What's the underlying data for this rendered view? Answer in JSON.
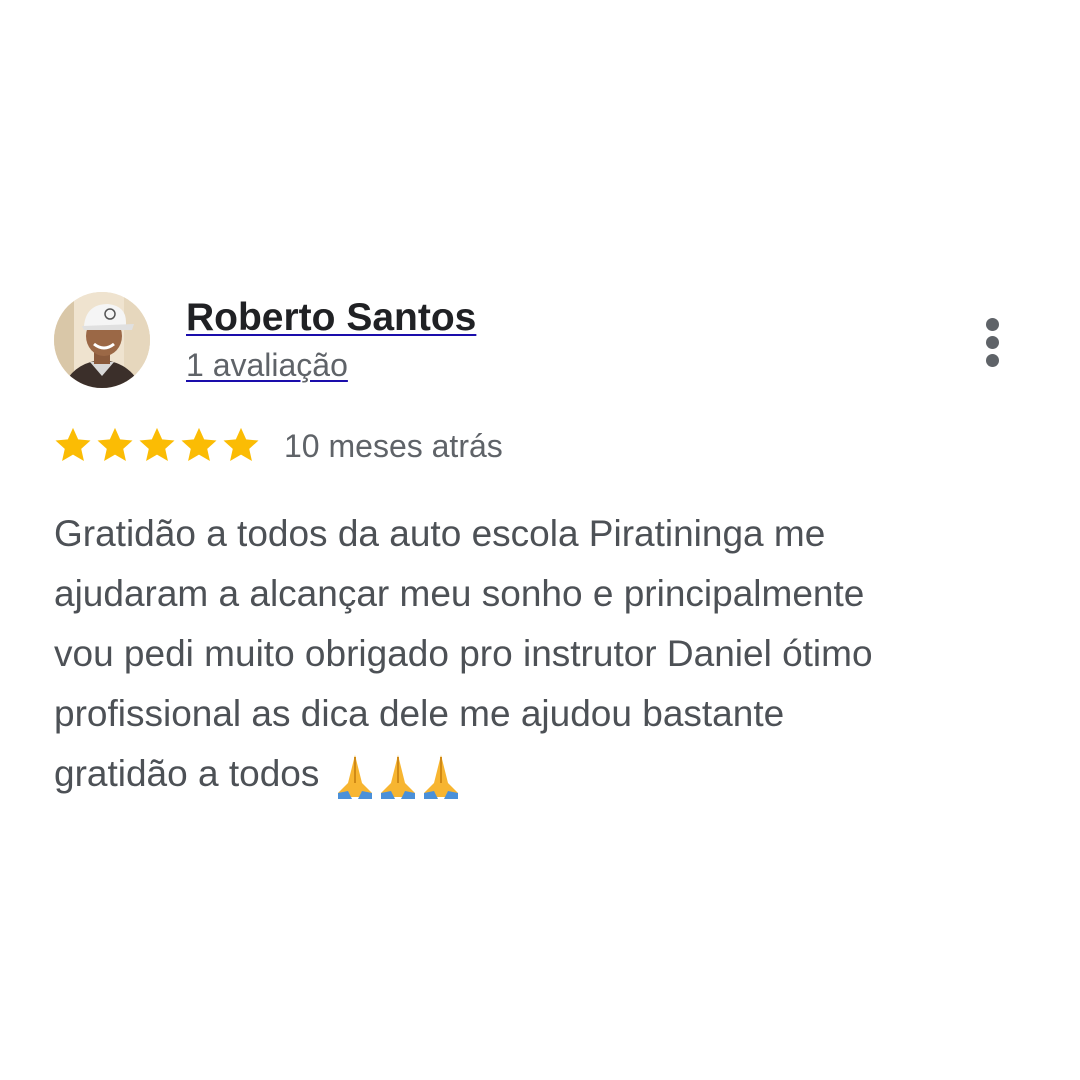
{
  "review": {
    "reviewer": {
      "name": "Roberto Santos",
      "review_count": "1 avaliação"
    },
    "rating": {
      "stars": 5,
      "max": 5,
      "color": "#fbbc04"
    },
    "date": "10 meses atrás",
    "text_lines": [
      "Gratidão a todos da auto escola Piratininga me",
      "ajudaram a alcançar meu sonho e principalmente",
      "vou pedi muito obrigado pro instrutor Daniel ótimo",
      "profissional as dica dele me ajudou bastante",
      "gratidão a todos"
    ],
    "emoji": "🙏🙏🙏",
    "menu_icon": "more-vert-icon"
  }
}
